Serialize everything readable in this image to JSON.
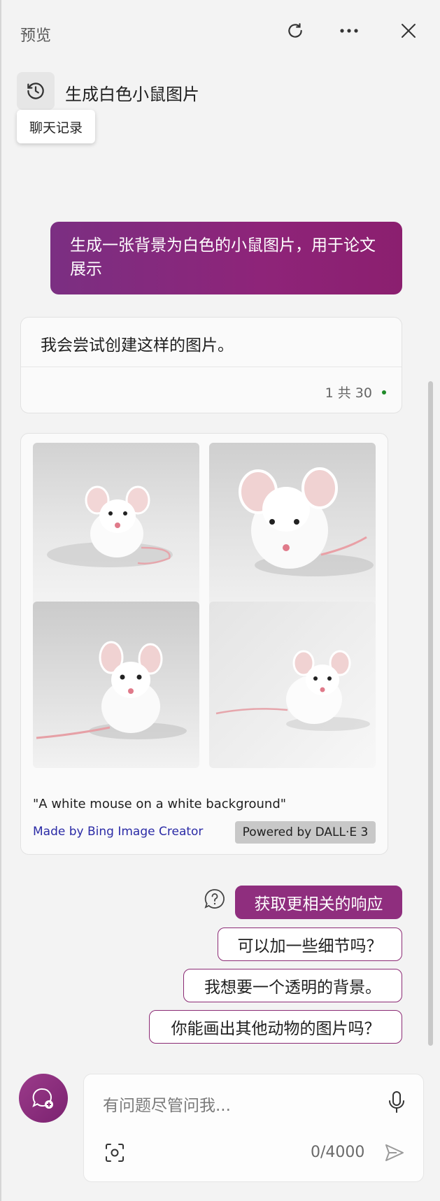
{
  "header": {
    "title": "预览",
    "icons": [
      "refresh-icon",
      "more-icon",
      "close-icon"
    ]
  },
  "conversation": {
    "history_icon": "history-icon",
    "title": "生成白色小鼠图片",
    "tooltip": "聊天记录"
  },
  "messages": {
    "user_text": "生成一张背景为白色的小鼠图片，用于论文展示",
    "bot_text": "我会尝试创建这样的图片。",
    "bot_count": "1 共 30"
  },
  "image_card": {
    "caption": "\"A white mouse on a white background\"",
    "maker": "Made by Bing Image Creator",
    "powered": "Powered by DALL·E 3"
  },
  "suggestions": {
    "primary": "获取更相关的响应",
    "items": [
      "可以加一些细节吗？",
      "我想要一个透明的背景。",
      "你能画出其他动物的图片吗？"
    ]
  },
  "input": {
    "placeholder": "有问题尽管问我...",
    "count": "0/4000"
  },
  "colors": {
    "accent": "#8f2e7e",
    "link": "#2b2ba6",
    "status_green": "#1f8a28"
  }
}
